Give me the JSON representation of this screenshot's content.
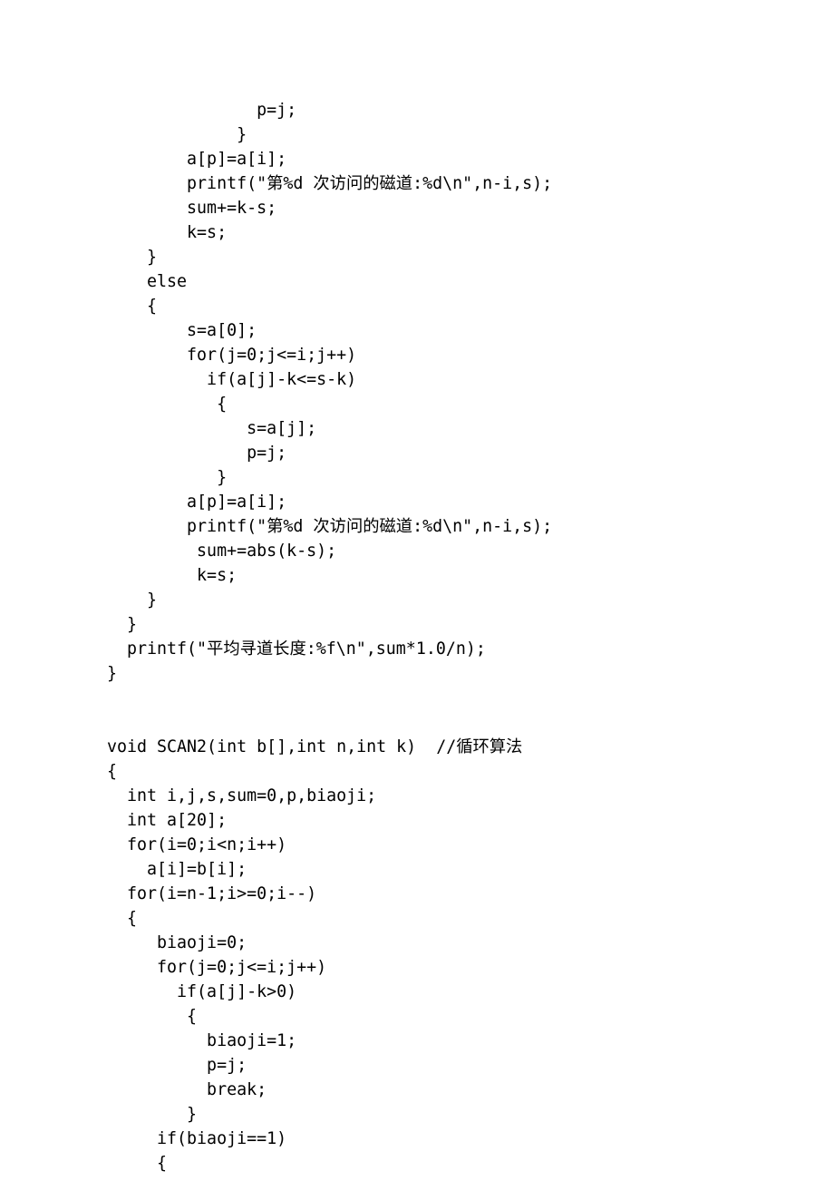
{
  "code_lines": [
    "               p=j;",
    "             }",
    "        a[p]=a[i];",
    "        printf(\"第%d 次访问的磁道:%d\\n\",n-i,s);",
    "        sum+=k-s;",
    "        k=s;",
    "    }",
    "    else",
    "    {",
    "        s=a[0];",
    "        for(j=0;j<=i;j++)",
    "          if(a[j]-k<=s-k)",
    "           {",
    "              s=a[j];",
    "              p=j;",
    "           }",
    "        a[p]=a[i];",
    "        printf(\"第%d 次访问的磁道:%d\\n\",n-i,s);",
    "         sum+=abs(k-s);",
    "         k=s;",
    "    }",
    "  }",
    "  printf(\"平均寻道长度:%f\\n\",sum*1.0/n);",
    "}",
    "",
    "",
    "void SCAN2(int b[],int n,int k)  //循环算法",
    "{",
    "  int i,j,s,sum=0,p,biaoji;",
    "  int a[20];",
    "  for(i=0;i<n;i++)",
    "    a[i]=b[i];",
    "  for(i=n-1;i>=0;i--)",
    "  {",
    "     biaoji=0;",
    "     for(j=0;j<=i;j++)",
    "       if(a[j]-k>0)",
    "        {",
    "          biaoji=1;",
    "          p=j;",
    "          break;",
    "        }",
    "     if(biaoji==1)",
    "     {"
  ]
}
